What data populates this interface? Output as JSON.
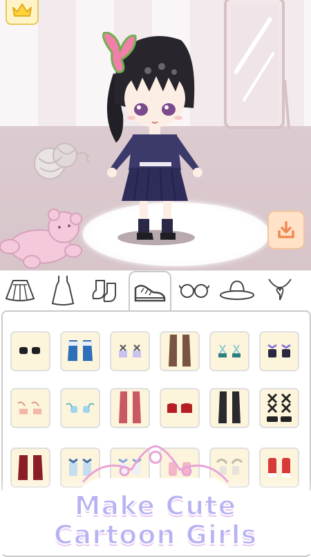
{
  "scene": {
    "crown_icon": "crown-icon",
    "download_icon": "download-icon",
    "colors": {
      "wall": "#f7f2f3",
      "floor": "#dccbd0",
      "accent": "#f29c6b"
    }
  },
  "tabs": [
    {
      "name": "skirt",
      "icon": "skirt-icon"
    },
    {
      "name": "dress",
      "icon": "dress-icon"
    },
    {
      "name": "socks",
      "icon": "socks-icon"
    },
    {
      "name": "shoes",
      "icon": "shoe-icon",
      "selected": true
    },
    {
      "name": "glasses",
      "icon": "glasses-icon"
    },
    {
      "name": "hat",
      "icon": "hat-icon"
    },
    {
      "name": "necklace",
      "icon": "necklace-icon"
    }
  ],
  "items": [
    "black-flats",
    "blue-boots",
    "lavender-sandals",
    "brown-tall-boots",
    "teal-strap-sandals",
    "purple-bow-shoes",
    "pink-wing-sandals",
    "sky-wing-flats",
    "red-tall-boots",
    "red-heels",
    "black-tall-boots",
    "black-lace-boots",
    "maroon-boots",
    "blue-bow-shoes",
    "white-bow-heels",
    "pink-sneakers",
    "winged-heels",
    "red-sneakers"
  ],
  "banner": {
    "line1": "Make Cute",
    "line2": "Cartoon Girls"
  }
}
